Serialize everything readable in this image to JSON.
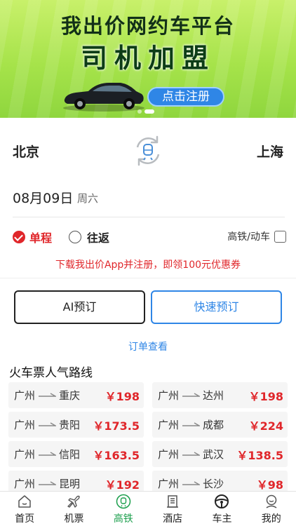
{
  "banner": {
    "headline": "我出价网约车平台",
    "big_text": "司机加盟",
    "cta_label": "点击注册"
  },
  "route": {
    "from_city": "北京",
    "to_city": "上海",
    "swap_icon": "swap-icon"
  },
  "date": {
    "value": "08月09日",
    "weekday": "周六"
  },
  "trip_type": {
    "one_way_label": "单程",
    "round_trip_label": "往返",
    "selected": "单程",
    "high_speed_label": "高铁/动车",
    "high_speed_checked": false
  },
  "promo_text": "下载我出价App并注册，即领100元优惠券",
  "actions": {
    "ai_book_label": "AI预订",
    "quick_book_label": "快速预订",
    "order_check_label": "订单查看"
  },
  "popular": {
    "title": "火车票人气路线",
    "routes": [
      {
        "from": "广州",
        "to": "重庆",
        "price": "￥198"
      },
      {
        "from": "广州",
        "to": "达州",
        "price": "￥198"
      },
      {
        "from": "广州",
        "to": "贵阳",
        "price": "￥173.5"
      },
      {
        "from": "广州",
        "to": "成都",
        "price": "￥224"
      },
      {
        "from": "广州",
        "to": "信阳",
        "price": "￥163.5"
      },
      {
        "from": "广州",
        "to": "武汉",
        "price": "￥138.5"
      },
      {
        "from": "广州",
        "to": "昆明",
        "price": "￥192"
      },
      {
        "from": "广州",
        "to": "长沙",
        "price": "￥98"
      }
    ]
  },
  "tabbar": {
    "active": "高铁",
    "items": [
      {
        "label": "首页",
        "icon": "home-icon"
      },
      {
        "label": "机票",
        "icon": "airplane-icon"
      },
      {
        "label": "高铁",
        "icon": "train-icon"
      },
      {
        "label": "酒店",
        "icon": "hotel-icon"
      },
      {
        "label": "车主",
        "icon": "steering-wheel-icon"
      },
      {
        "label": "我的",
        "icon": "profile-icon"
      }
    ]
  },
  "colors": {
    "accent_red": "#e0262a",
    "accent_blue": "#2f86e6",
    "active_green": "#1a9e4b"
  }
}
